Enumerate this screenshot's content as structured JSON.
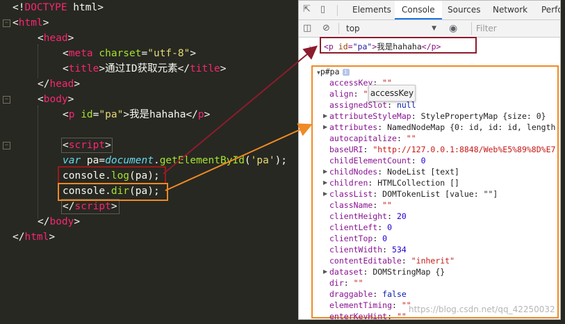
{
  "editor": {
    "lines": [
      {
        "id": "l1",
        "parts": [
          [
            "t-pun",
            "<!"
          ],
          [
            "t-tag",
            "DOCTYPE"
          ],
          [
            "t-pun",
            " html>"
          ]
        ]
      },
      {
        "id": "l2",
        "parts": [
          [
            "t-pun",
            "<"
          ],
          [
            "t-tag",
            "html"
          ],
          [
            "t-pun",
            ">"
          ]
        ]
      },
      {
        "id": "l3",
        "parts": [
          [
            "t-pun",
            "<"
          ],
          [
            "t-tag",
            "head"
          ],
          [
            "t-pun",
            ">"
          ]
        ]
      },
      {
        "id": "l4",
        "parts": [
          [
            "t-pun",
            "<"
          ],
          [
            "t-tag",
            "meta"
          ],
          [
            "t-pun",
            " "
          ],
          [
            "t-att",
            "charset"
          ],
          [
            "t-pun",
            "="
          ],
          [
            "t-str",
            "\"utf-8\""
          ],
          [
            "t-pun",
            ">"
          ]
        ]
      },
      {
        "id": "l5",
        "parts": [
          [
            "t-pun",
            "<"
          ],
          [
            "t-tag",
            "title"
          ],
          [
            "t-pun",
            ">"
          ],
          [
            "t-txt",
            "通过ID获取元素"
          ],
          [
            "t-pun",
            "</"
          ],
          [
            "t-tag",
            "title"
          ],
          [
            "t-pun",
            ">"
          ]
        ]
      },
      {
        "id": "l6",
        "parts": [
          [
            "t-pun",
            "</"
          ],
          [
            "t-tag",
            "head"
          ],
          [
            "t-pun",
            ">"
          ]
        ]
      },
      {
        "id": "l7",
        "parts": [
          [
            "t-pun",
            "<"
          ],
          [
            "t-tag",
            "body"
          ],
          [
            "t-pun",
            ">"
          ]
        ]
      },
      {
        "id": "l8",
        "parts": [
          [
            "t-pun",
            "<"
          ],
          [
            "t-tag",
            "p"
          ],
          [
            "t-pun",
            " "
          ],
          [
            "t-att",
            "id"
          ],
          [
            "t-pun",
            "="
          ],
          [
            "t-str",
            "\"pa\""
          ],
          [
            "t-pun",
            ">"
          ],
          [
            "t-txt",
            "我是hahaha"
          ],
          [
            "t-pun",
            "</"
          ],
          [
            "t-tag",
            "p"
          ],
          [
            "t-pun",
            ">"
          ]
        ]
      },
      {
        "id": "l9",
        "parts": []
      },
      {
        "id": "l10",
        "parts": [
          [
            "t-pun",
            "<"
          ],
          [
            "t-tag",
            "script"
          ],
          [
            "t-pun",
            ">"
          ]
        ]
      },
      {
        "id": "l11",
        "parts": [
          [
            "t-kw",
            "var"
          ],
          [
            "t-txt",
            " pa="
          ],
          [
            "t-kw",
            "document"
          ],
          [
            "t-txt",
            "."
          ],
          [
            "t-fn",
            "getElementById"
          ],
          [
            "t-txt",
            "("
          ],
          [
            "t-str",
            "'pa'"
          ],
          [
            "t-txt",
            ");"
          ]
        ]
      },
      {
        "id": "l12",
        "parts": [
          [
            "t-txt",
            "console."
          ],
          [
            "t-fn",
            "log"
          ],
          [
            "t-txt",
            "(pa);"
          ]
        ]
      },
      {
        "id": "l13",
        "parts": [
          [
            "t-txt",
            "console."
          ],
          [
            "t-fn",
            "dir"
          ],
          [
            "t-txt",
            "(pa);"
          ]
        ]
      },
      {
        "id": "l14",
        "parts": [
          [
            "t-pun",
            "</"
          ],
          [
            "t-tag",
            "script"
          ],
          [
            "t-pun",
            ">"
          ]
        ]
      },
      {
        "id": "l15",
        "parts": [
          [
            "t-pun",
            "</"
          ],
          [
            "t-tag",
            "body"
          ],
          [
            "t-pun",
            ">"
          ]
        ]
      },
      {
        "id": "l16",
        "parts": [
          [
            "t-pun",
            "</"
          ],
          [
            "t-tag",
            "html"
          ],
          [
            "t-pun",
            ">"
          ]
        ]
      }
    ]
  },
  "devtools": {
    "tabs": [
      "Elements",
      "Console",
      "Sources",
      "Network",
      "Perfo"
    ],
    "active_tab": "Console",
    "context_select": "top",
    "filter_placeholder": "Filter",
    "log_element": {
      "open": "<p",
      "attr": "id",
      "val": "\"pa\"",
      "close": ">",
      "text": "我是hahaha",
      "end": "</p>"
    },
    "dir_root": "p#pa",
    "tooltip": "accessKey",
    "properties": [
      {
        "k": "accessKey",
        "v": "\"\"",
        "t": "pv-str",
        "exp": false
      },
      {
        "k": "align",
        "v": "\"",
        "t": "pv-str",
        "exp": false
      },
      {
        "k": "assignedSlot",
        "v": "null",
        "t": "pv-kw",
        "exp": false
      },
      {
        "k": "attributeStyleMap",
        "v": "StylePropertyMap {size: 0}",
        "t": "pv-obj",
        "exp": true
      },
      {
        "k": "attributes",
        "v": "NamedNodeMap {0: id, id: id, length",
        "t": "pv-obj",
        "exp": true
      },
      {
        "k": "autocapitalize",
        "v": "\"\"",
        "t": "pv-str",
        "exp": false
      },
      {
        "k": "baseURI",
        "v": "\"http://127.0.0.1:8848/Web%E5%89%8D%E7",
        "t": "pv-str",
        "exp": false
      },
      {
        "k": "childElementCount",
        "v": "0",
        "t": "pv-num",
        "exp": false
      },
      {
        "k": "childNodes",
        "v": "NodeList [text]",
        "t": "pv-obj",
        "exp": true
      },
      {
        "k": "children",
        "v": "HTMLCollection []",
        "t": "pv-obj",
        "exp": true
      },
      {
        "k": "classList",
        "v": "DOMTokenList [value: \"\"]",
        "t": "pv-obj",
        "exp": true
      },
      {
        "k": "className",
        "v": "\"\"",
        "t": "pv-str",
        "exp": false
      },
      {
        "k": "clientHeight",
        "v": "20",
        "t": "pv-num",
        "exp": false
      },
      {
        "k": "clientLeft",
        "v": "0",
        "t": "pv-num",
        "exp": false
      },
      {
        "k": "clientTop",
        "v": "0",
        "t": "pv-num",
        "exp": false
      },
      {
        "k": "clientWidth",
        "v": "534",
        "t": "pv-num",
        "exp": false
      },
      {
        "k": "contentEditable",
        "v": "\"inherit\"",
        "t": "pv-str",
        "exp": false
      },
      {
        "k": "dataset",
        "v": "DOMStringMap {}",
        "t": "pv-obj",
        "exp": true
      },
      {
        "k": "dir",
        "v": "\"\"",
        "t": "pv-str",
        "exp": false
      },
      {
        "k": "draggable",
        "v": "false",
        "t": "pv-kw",
        "exp": false
      },
      {
        "k": "elementTiming",
        "v": "\"\"",
        "t": "pv-str",
        "exp": false
      },
      {
        "k": "enterKeyHint",
        "v": "\"\"",
        "t": "pv-str",
        "exp": false
      }
    ],
    "watermark": "https://blog.csdn.net/qq_42250032"
  },
  "colors": {
    "log_highlight": "#9a1a1a",
    "dir_highlight": "#f08a24"
  }
}
